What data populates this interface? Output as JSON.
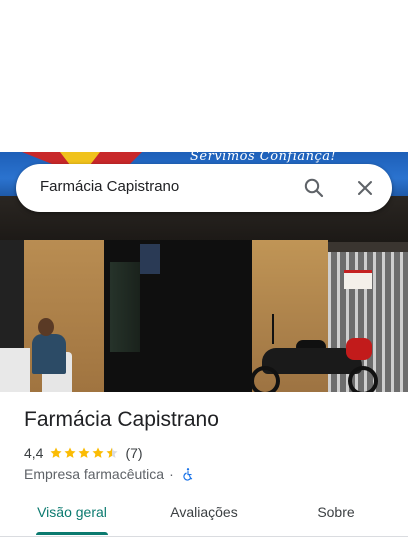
{
  "search": {
    "query": "Farmácia Capistrano"
  },
  "photo": {
    "banner_text": "Servimos Confiança!"
  },
  "place": {
    "title": "Farmácia Capistrano",
    "rating": "4,4",
    "rating_value": 4.4,
    "review_count": "(7)",
    "category": "Empresa farmacêutica",
    "separator": "·"
  },
  "tabs": [
    {
      "label": "Visão geral",
      "active": true
    },
    {
      "label": "Avaliações",
      "active": false
    },
    {
      "label": "Sobre",
      "active": false
    }
  ],
  "icons": {
    "search": "search-icon",
    "close": "close-icon",
    "accessibility": "wheelchair-icon",
    "star": "star-icon"
  },
  "colors": {
    "accent": "#0b7a6f",
    "star": "#fbbc04",
    "accessibility": "#1a73e8"
  }
}
